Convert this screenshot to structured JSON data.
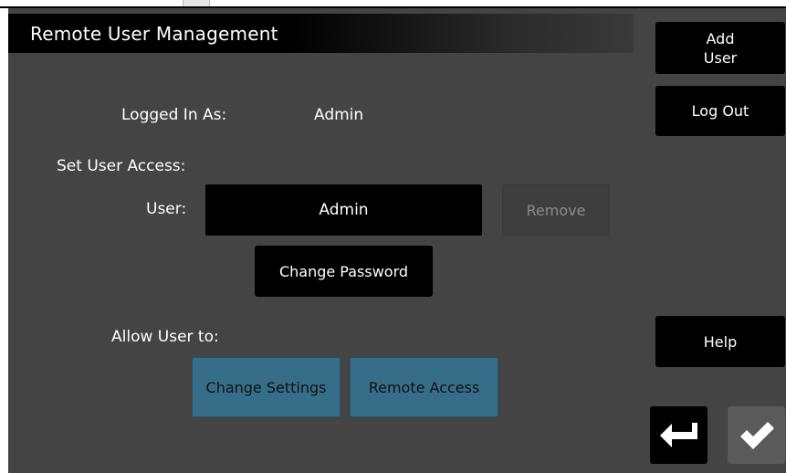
{
  "title": "Remote User Management",
  "side_buttons": {
    "add_user": "Add\nUser",
    "log_out": "Log Out",
    "help": "Help"
  },
  "logged_in": {
    "label": "Logged In As:",
    "value": "Admin"
  },
  "set_access": {
    "label": "Set User Access:",
    "user_label": "User:",
    "user_value": "Admin",
    "remove": "Remove",
    "change_password": "Change Password"
  },
  "allow": {
    "label": "Allow User to:",
    "change_settings": "Change Settings",
    "remote_access": "Remote Access"
  },
  "icons": {
    "back": "return-arrow-icon",
    "confirm": "checkmark-icon"
  },
  "colors": {
    "background": "#444444",
    "toggle_active": "#366e8a",
    "button": "#000000"
  }
}
